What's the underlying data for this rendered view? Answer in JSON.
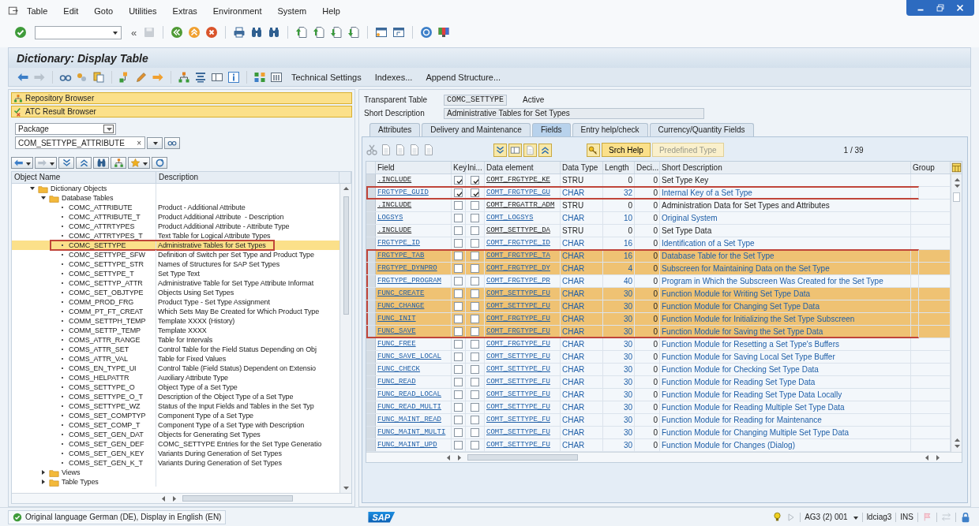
{
  "menu": [
    "Table",
    "Edit",
    "Goto",
    "Utilities",
    "Extras",
    "Environment",
    "System",
    "Help"
  ],
  "toolbar": {
    "history": "«"
  },
  "title": "Dictionary: Display Table",
  "app_toolbar": {
    "buttons": [
      "Technical Settings",
      "Indexes...",
      "Append Structure..."
    ]
  },
  "left": {
    "browsers": [
      "Repository Browser",
      "ATC Result Browser"
    ],
    "object_type": "Package",
    "object_name": "COM_SETTYPE_ATTRIBUTE",
    "clear": "×",
    "tree": {
      "columns": [
        "Object Name",
        "Description"
      ],
      "nodes": [
        {
          "name": "Dictionary Objects",
          "kind": "folder",
          "expanded": true,
          "selected": false,
          "children": [
            {
              "name": "Database Tables",
              "kind": "folder",
              "expanded": true,
              "selected": false,
              "children": [
                {
                  "name": "COMC_ATTRIBUTE",
                  "kind": "table",
                  "description": "Product - Additional Attribute",
                  "selected": false,
                  "boxed": false
                },
                {
                  "name": "COMC_ATTRIBUTE_T",
                  "kind": "table",
                  "description": "Product Additional Attribute  - Description",
                  "selected": false,
                  "boxed": false
                },
                {
                  "name": "COMC_ATTRTYPES",
                  "kind": "table",
                  "description": "Product Additional Attribute - Attribute Type",
                  "selected": false,
                  "boxed": false
                },
                {
                  "name": "COMC_ATTRTYPES_T",
                  "kind": "table",
                  "description": "Text Table for Logical Attribute Types",
                  "selected": false,
                  "boxed": false
                },
                {
                  "name": "COMC_SETTYPE",
                  "kind": "table",
                  "description": "Administrative Tables for Set Types",
                  "selected": true,
                  "boxed": true
                },
                {
                  "name": "COMC_SETTYPE_SFW",
                  "kind": "table",
                  "description": "Definition of Switch per Set Type and Product Type",
                  "selected": false,
                  "boxed": false
                },
                {
                  "name": "COMC_SETTYPE_STR",
                  "kind": "table",
                  "description": "Names of Structures for SAP Set Types",
                  "selected": false,
                  "boxed": false
                },
                {
                  "name": "COMC_SETTYPE_T",
                  "kind": "table",
                  "description": "Set Type Text",
                  "selected": false,
                  "boxed": false
                },
                {
                  "name": "COMC_SETTYP_ATTR",
                  "kind": "table",
                  "description": "Administrative Table for Set Type Attribute Informat",
                  "selected": false,
                  "boxed": false
                },
                {
                  "name": "COMC_SET_OBJTYPE",
                  "kind": "table",
                  "description": "Objects Using Set Types",
                  "selected": false,
                  "boxed": false
                },
                {
                  "name": "COMM_PROD_FRG",
                  "kind": "table",
                  "description": "Product Type - Set Type Assignment",
                  "selected": false,
                  "boxed": false
                },
                {
                  "name": "COMM_PT_FT_CREAT",
                  "kind": "table",
                  "description": "Which Sets May Be Created for Which Product Type",
                  "selected": false,
                  "boxed": false
                },
                {
                  "name": "COMM_SETTPH_TEMP",
                  "kind": "table",
                  "description": "Template XXXX (History)",
                  "selected": false,
                  "boxed": false
                },
                {
                  "name": "COMM_SETTP_TEMP",
                  "kind": "table",
                  "description": "Template XXXX",
                  "selected": false,
                  "boxed": false
                },
                {
                  "name": "COMS_ATTR_RANGE",
                  "kind": "table",
                  "description": "Table for Intervals",
                  "selected": false,
                  "boxed": false
                },
                {
                  "name": "COMS_ATTR_SET",
                  "kind": "table",
                  "description": "Control Table for the Field Status Depending on Obj",
                  "selected": false,
                  "boxed": false
                },
                {
                  "name": "COMS_ATTR_VAL",
                  "kind": "table",
                  "description": "Table for Fixed Values",
                  "selected": false,
                  "boxed": false
                },
                {
                  "name": "COMS_EN_TYPE_UI",
                  "kind": "table",
                  "description": "Control Table (Field Status) Dependent on Extensio",
                  "selected": false,
                  "boxed": false
                },
                {
                  "name": "COMS_HELPATTR",
                  "kind": "table",
                  "description": "Auxiliary Attribute Type",
                  "selected": false,
                  "boxed": false
                },
                {
                  "name": "COMS_SETTYPE_O",
                  "kind": "table",
                  "description": "Object Type of a Set Type",
                  "selected": false,
                  "boxed": false
                },
                {
                  "name": "COMS_SETTYPE_O_T",
                  "kind": "table",
                  "description": "Description of the Object Type of a Set Type",
                  "selected": false,
                  "boxed": false
                },
                {
                  "name": "COMS_SETTYPE_WZ",
                  "kind": "table",
                  "description": "Status of the Input Fields and Tables in the Set Typ",
                  "selected": false,
                  "boxed": false
                },
                {
                  "name": "COMS_SET_COMPTYP",
                  "kind": "table",
                  "description": "Component Type of a Set Type",
                  "selected": false,
                  "boxed": false
                },
                {
                  "name": "COMS_SET_COMP_T",
                  "kind": "table",
                  "description": "Component Type of a Set Type with Description",
                  "selected": false,
                  "boxed": false
                },
                {
                  "name": "COMS_SET_GEN_DAT",
                  "kind": "table",
                  "description": "Objects for Generating Set Types",
                  "selected": false,
                  "boxed": false
                },
                {
                  "name": "COMS_SET_GEN_DEF",
                  "kind": "table",
                  "description": "COMC_SETTYPE Entries for the Set Type Generatio",
                  "selected": false,
                  "boxed": false
                },
                {
                  "name": "COMS_SET_GEN_KEY",
                  "kind": "table",
                  "description": "Variants During Generation of Set Types",
                  "selected": false,
                  "boxed": false
                },
                {
                  "name": "COMS_SET_GEN_K_T",
                  "kind": "table",
                  "description": "Variants During Generation of Set Types",
                  "selected": false,
                  "boxed": false
                }
              ]
            },
            {
              "name": "Views",
              "kind": "folder",
              "expanded": false,
              "selected": false
            },
            {
              "name": "Table Types",
              "kind": "folder",
              "expanded": false,
              "selected": false
            }
          ]
        }
      ]
    }
  },
  "right": {
    "type_label": "Transparent Table",
    "table_name": "COMC_SETTYPE",
    "status": "Active",
    "desc_label": "Short Description",
    "description": "Administrative Tables for Set Types",
    "tabs": [
      {
        "label": "Attributes",
        "selected": false
      },
      {
        "label": "Delivery and Maintenance",
        "selected": false
      },
      {
        "label": "Fields",
        "selected": true
      },
      {
        "label": "Entry help/check",
        "selected": false
      },
      {
        "label": "Currency/Quantity Fields",
        "selected": false
      }
    ],
    "srch_help": "Srch Help",
    "predefined": {
      "label": "Predefined Type",
      "disabled": true
    },
    "counter": "1 / 39",
    "columns": [
      "Field",
      "Key",
      "Ini...",
      "Data element",
      "Data Type",
      "Length",
      "Deci...",
      "Short Description",
      "Group"
    ],
    "rows": [
      {
        "field": ".INCLUDE",
        "kind": "include",
        "key": true,
        "initial": true,
        "data_element": "COMT_FRGTYPE_KE",
        "data_type": "STRU",
        "length": "0",
        "decimals": "0",
        "description": "Set Type Key",
        "highlighted": false,
        "boxed": false
      },
      {
        "field": "FRGTYPE_GUID",
        "kind": "field",
        "key": true,
        "initial": true,
        "data_element": "COMT_FRGTYPE_GU",
        "data_type": "CHAR",
        "length": "32",
        "decimals": "0",
        "description": "Internal Key of a Set Type",
        "highlighted": false,
        "boxed": true
      },
      {
        "field": ".INCLUDE",
        "kind": "include",
        "key": false,
        "initial": false,
        "data_element": "COMT_FRGATTR_ADM",
        "data_type": "STRU",
        "length": "0",
        "decimals": "0",
        "description": "Administration Data for Set Types and Attributes",
        "highlighted": false,
        "boxed": false
      },
      {
        "field": "LOGSYS",
        "kind": "field",
        "key": false,
        "initial": false,
        "data_element": "COMT_LOGSYS",
        "data_type": "CHAR",
        "length": "10",
        "decimals": "0",
        "description": "Original System",
        "highlighted": false,
        "boxed": false
      },
      {
        "field": ".INCLUDE",
        "kind": "include",
        "key": false,
        "initial": false,
        "data_element": "COMT_SETTYPE_DA",
        "data_type": "STRU",
        "length": "0",
        "decimals": "0",
        "description": "Set Type Data",
        "highlighted": false,
        "boxed": false
      },
      {
        "field": "FRGTYPE_ID",
        "kind": "field",
        "key": false,
        "initial": false,
        "data_element": "COMT_FRGTYPE_ID",
        "data_type": "CHAR",
        "length": "16",
        "decimals": "0",
        "description": "Identification of a Set Type",
        "highlighted": false,
        "boxed": false
      },
      {
        "field": "FRGTYPE_TAB",
        "kind": "field",
        "key": false,
        "initial": false,
        "data_element": "COMT_FRGTYPE_TA",
        "data_type": "CHAR",
        "length": "16",
        "decimals": "0",
        "description": "Database Table for the Set Type",
        "highlighted": true,
        "boxed": true
      },
      {
        "field": "FRGTYPE_DYNPRO",
        "kind": "field",
        "key": false,
        "initial": false,
        "data_element": "COMT_FRGTYPE_DY",
        "data_type": "CHAR",
        "length": "4",
        "decimals": "0",
        "description": "Subscreen for Maintaining Data on the Set Type",
        "highlighted": true,
        "boxed": true
      },
      {
        "field": "FRGTYPE_PROGRAM",
        "kind": "field",
        "key": false,
        "initial": false,
        "data_element": "COMT_FRGTYPE_PR",
        "data_type": "CHAR",
        "length": "40",
        "decimals": "0",
        "description": "Program in Which the Subscreen Was Created for the Set Type",
        "highlighted": false,
        "boxed": true
      },
      {
        "field": "FUNC_CREATE",
        "kind": "field",
        "key": false,
        "initial": false,
        "data_element": "COMT_SETTYPE_FU",
        "data_type": "CHAR",
        "length": "30",
        "decimals": "0",
        "description": "Function Module for Writing Set Type Data",
        "highlighted": true,
        "boxed": true
      },
      {
        "field": "FUNC_CHANGE",
        "kind": "field",
        "key": false,
        "initial": false,
        "data_element": "COMT_SETTYPE_FU",
        "data_type": "CHAR",
        "length": "30",
        "decimals": "0",
        "description": "Function Module for Changing Set Type Data",
        "highlighted": true,
        "boxed": true
      },
      {
        "field": "FUNC_INIT",
        "kind": "field",
        "key": false,
        "initial": false,
        "data_element": "COMT_FRGTYPE_FU",
        "data_type": "CHAR",
        "length": "30",
        "decimals": "0",
        "description": "Function Module for Initializing the Set Type Subscreen",
        "highlighted": true,
        "boxed": true
      },
      {
        "field": "FUNC_SAVE",
        "kind": "field",
        "key": false,
        "initial": false,
        "data_element": "COMT_FRGTYPE_FU",
        "data_type": "CHAR",
        "length": "30",
        "decimals": "0",
        "description": "Function Module for Saving the Set Type Data",
        "highlighted": true,
        "boxed": true
      },
      {
        "field": "FUNC_FREE",
        "kind": "field",
        "key": false,
        "initial": false,
        "data_element": "COMT_FRGTYPE_FU",
        "data_type": "CHAR",
        "length": "30",
        "decimals": "0",
        "description": "Function Module for Resetting a Set Type's Buffers",
        "highlighted": false,
        "boxed": false
      },
      {
        "field": "FUNC_SAVE_LOCAL",
        "kind": "field",
        "key": false,
        "initial": false,
        "data_element": "COMT_SETTYPE_FU",
        "data_type": "CHAR",
        "length": "30",
        "decimals": "0",
        "description": "Function Module for Saving Local Set Type Buffer",
        "highlighted": false,
        "boxed": false
      },
      {
        "field": "FUNC_CHECK",
        "kind": "field",
        "key": false,
        "initial": false,
        "data_element": "COMT_SETTYPE_FU",
        "data_type": "CHAR",
        "length": "30",
        "decimals": "0",
        "description": "Function Module for Checking Set Type Data",
        "highlighted": false,
        "boxed": false
      },
      {
        "field": "FUNC_READ",
        "kind": "field",
        "key": false,
        "initial": false,
        "data_element": "COMT_SETTYPE_FU",
        "data_type": "CHAR",
        "length": "30",
        "decimals": "0",
        "description": "Function Module for Reading Set Type Data",
        "highlighted": false,
        "boxed": false
      },
      {
        "field": "FUNC_READ_LOCAL",
        "kind": "field",
        "key": false,
        "initial": false,
        "data_element": "COMT_SETTYPE_FU",
        "data_type": "CHAR",
        "length": "30",
        "decimals": "0",
        "description": "Function Module for Reading Set Type Data Locally",
        "highlighted": false,
        "boxed": false
      },
      {
        "field": "FUNC_READ_MULTI",
        "kind": "field",
        "key": false,
        "initial": false,
        "data_element": "COMT_SETTYPE_FU",
        "data_type": "CHAR",
        "length": "30",
        "decimals": "0",
        "description": "Function Module for Reading Multiple Set Type Data",
        "highlighted": false,
        "boxed": false
      },
      {
        "field": "FUNC_MAINT_READ",
        "kind": "field",
        "key": false,
        "initial": false,
        "data_element": "COMT_SETTYPE_FU",
        "data_type": "CHAR",
        "length": "30",
        "decimals": "0",
        "description": "Function Module for Reading for Maintenance",
        "highlighted": false,
        "boxed": false
      },
      {
        "field": "FUNC_MAINT_MULTI",
        "kind": "field",
        "key": false,
        "initial": false,
        "data_element": "COMT_SETTYPE_FU",
        "data_type": "CHAR",
        "length": "30",
        "decimals": "0",
        "description": "Function Module for Changing Multiple Set Type Data",
        "highlighted": false,
        "boxed": false
      },
      {
        "field": "FUNC_MAINT_UPD",
        "kind": "field",
        "key": false,
        "initial": false,
        "data_element": "COMT_SETTYPE_FU",
        "data_type": "CHAR",
        "length": "30",
        "decimals": "0",
        "description": "Function Module for Changes (Dialog)",
        "highlighted": false,
        "boxed": false
      }
    ]
  },
  "status": {
    "message": "Original language German (DE), Display in English (EN)",
    "logo": "SAP",
    "system": "AG3 (2) 001",
    "server": "ldciag3",
    "mode": "INS"
  }
}
